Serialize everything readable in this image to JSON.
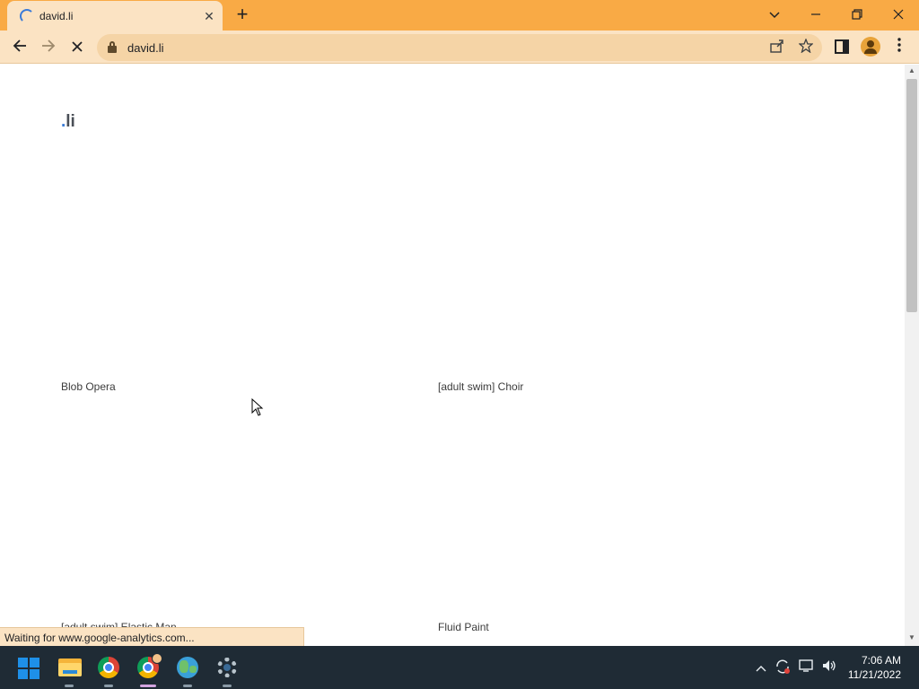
{
  "browser": {
    "tab_title": "david.li",
    "tab_close_glyph": "✕",
    "new_tab_glyph": "+",
    "url": "david.li",
    "status_text": "Waiting for www.google-analytics.com...",
    "icons": {
      "loading": "loading-spinner-icon",
      "back": "back-arrow-icon",
      "forward": "forward-arrow-icon",
      "stop": "stop-reload-icon",
      "lock": "lock-icon",
      "share": "share-icon",
      "bookmark": "star-icon",
      "side_panel": "side-panel-icon",
      "profile": "profile-avatar-icon",
      "menu": "kebab-menu-icon"
    },
    "accent_color": "#f9aa45"
  },
  "page": {
    "logo_dot": ".",
    "logo_text": "li",
    "cards": [
      {
        "label": "Blob Opera"
      },
      {
        "label": "[adult swim] Choir"
      },
      {
        "label": "[adult swim] Elastic Man"
      },
      {
        "label": "Fluid Paint"
      }
    ]
  },
  "taskbar": {
    "apps": [
      "windows-start-icon",
      "file-explorer-icon",
      "chrome-icon",
      "chrome-profile-icon",
      "globe-app-icon",
      "settings-gear-icon"
    ],
    "time": "7:06 AM",
    "date": "11/21/2022"
  }
}
